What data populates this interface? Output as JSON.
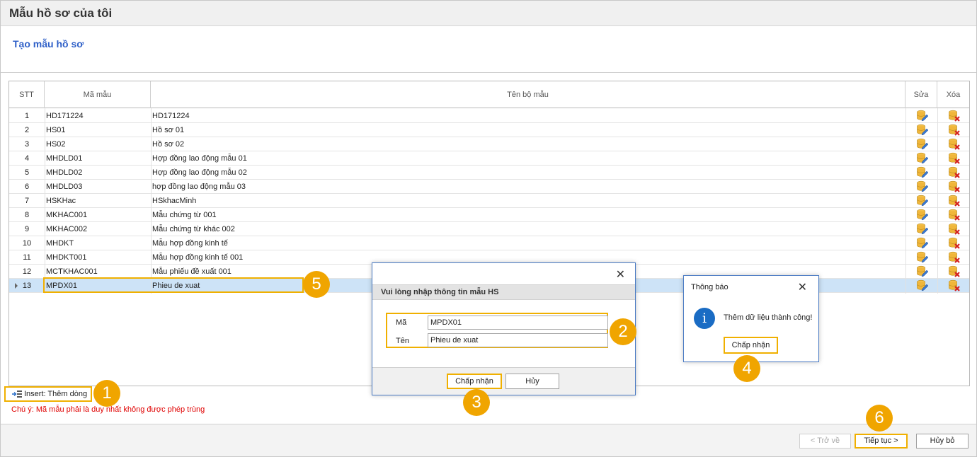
{
  "window": {
    "title": "Mẫu hồ sơ của tôi"
  },
  "subhead": "Tạo mẫu hồ sơ",
  "grid": {
    "columns": [
      "STT",
      "Mã mẫu",
      "Tên bộ mẫu",
      "Sửa",
      "Xóa"
    ],
    "rows": [
      {
        "stt": "1",
        "ma": "HD171224",
        "ten": "HD171224"
      },
      {
        "stt": "2",
        "ma": "HS01",
        "ten": "Hồ sơ 01"
      },
      {
        "stt": "3",
        "ma": "HS02",
        "ten": "Hồ sơ 02"
      },
      {
        "stt": "4",
        "ma": "MHDLD01",
        "ten": "Hợp đồng lao động mẫu 01"
      },
      {
        "stt": "5",
        "ma": "MHDLD02",
        "ten": "Hợp đồng lao động mẫu 02"
      },
      {
        "stt": "6",
        "ma": "MHDLD03",
        "ten": "hợp đồng lao động mẫu 03"
      },
      {
        "stt": "7",
        "ma": "HSKHac",
        "ten": "HSkhacMinh"
      },
      {
        "stt": "8",
        "ma": "MKHAC001",
        "ten": "Mẫu chứng từ 001"
      },
      {
        "stt": "9",
        "ma": "MKHAC002",
        "ten": "Mẫu chứng từ khác 002"
      },
      {
        "stt": "10",
        "ma": "MHDKT",
        "ten": "Mẫu hợp đồng kinh tế"
      },
      {
        "stt": "11",
        "ma": "MHDKT001",
        "ten": "Mẫu hợp đồng kinh tế 001"
      },
      {
        "stt": "12",
        "ma": "MCTKHAC001",
        "ten": "Mẫu phiếu đề xuất 001"
      },
      {
        "stt": "13",
        "ma": "MPDX01",
        "ten": "Phieu de xuat"
      }
    ],
    "edit_icon": "database-edit-icon",
    "delete_icon": "database-delete-icon"
  },
  "insert_button": "Insert: Thêm dòng",
  "note": "Chú ý: Mã mẫu phải là duy nhất không được phép trùng",
  "footer": {
    "back": "< Trở về",
    "next": "Tiếp tục >",
    "cancel": "Hủy bỏ"
  },
  "input_dialog": {
    "header": "Vui lòng nhập thông tin mẫu HS",
    "ma_label": "Mã",
    "ma_value": "MPDX01",
    "ten_label": "Tên",
    "ten_value": "Phieu de xuat",
    "ok": "Chấp nhận",
    "cancel": "Hủy"
  },
  "notification": {
    "title": "Thông báo",
    "message": "Thêm dữ liệu thành công!",
    "ok": "Chấp nhận"
  },
  "callouts": [
    "1",
    "2",
    "3",
    "4",
    "5",
    "6"
  ],
  "colors": {
    "accent": "#f0a500",
    "title_blue": "#2f60c8",
    "note_red": "#e00000",
    "selected_row": "#cde3f7",
    "dialog_border": "#4a7bc4"
  }
}
